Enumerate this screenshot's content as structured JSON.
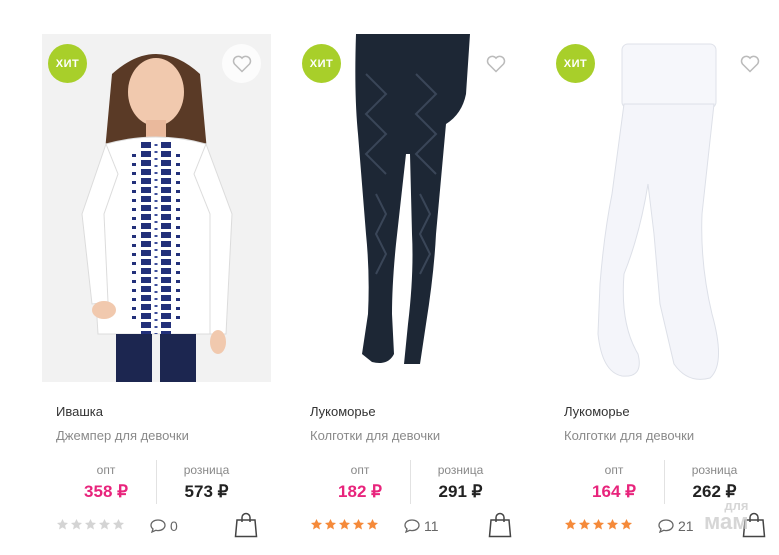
{
  "products": [
    {
      "badge": "ХИТ",
      "brand": "Ивашка",
      "description": "Джемпер для девочки",
      "opt_label": "опт",
      "opt_price": "358 ₽",
      "retail_label": "розница",
      "retail_price": "573 ₽",
      "rating": 0,
      "comments": "0",
      "image_icon": "girl-jumper-photo"
    },
    {
      "badge": "ХИТ",
      "brand": "Лукоморье",
      "description": "Колготки для девочки",
      "opt_label": "опт",
      "opt_price": "182 ₽",
      "retail_label": "розница",
      "retail_price": "291 ₽",
      "rating": 5,
      "comments": "11",
      "image_icon": "navy-tights-photo"
    },
    {
      "badge": "ХИТ",
      "brand": "Лукоморье",
      "description": "Колготки для девочки",
      "opt_label": "опт",
      "opt_price": "164 ₽",
      "retail_label": "розница",
      "retail_price": "262 ₽",
      "rating": 5,
      "comments": "21",
      "image_icon": "white-tights-photo"
    }
  ],
  "watermark": {
    "line1": "для",
    "line2": "мам"
  },
  "colors": {
    "badge": "#a8cf2a",
    "opt_price": "#e8247c",
    "star_filled": "#f58a3a",
    "star_empty": "#d4d4d4"
  }
}
